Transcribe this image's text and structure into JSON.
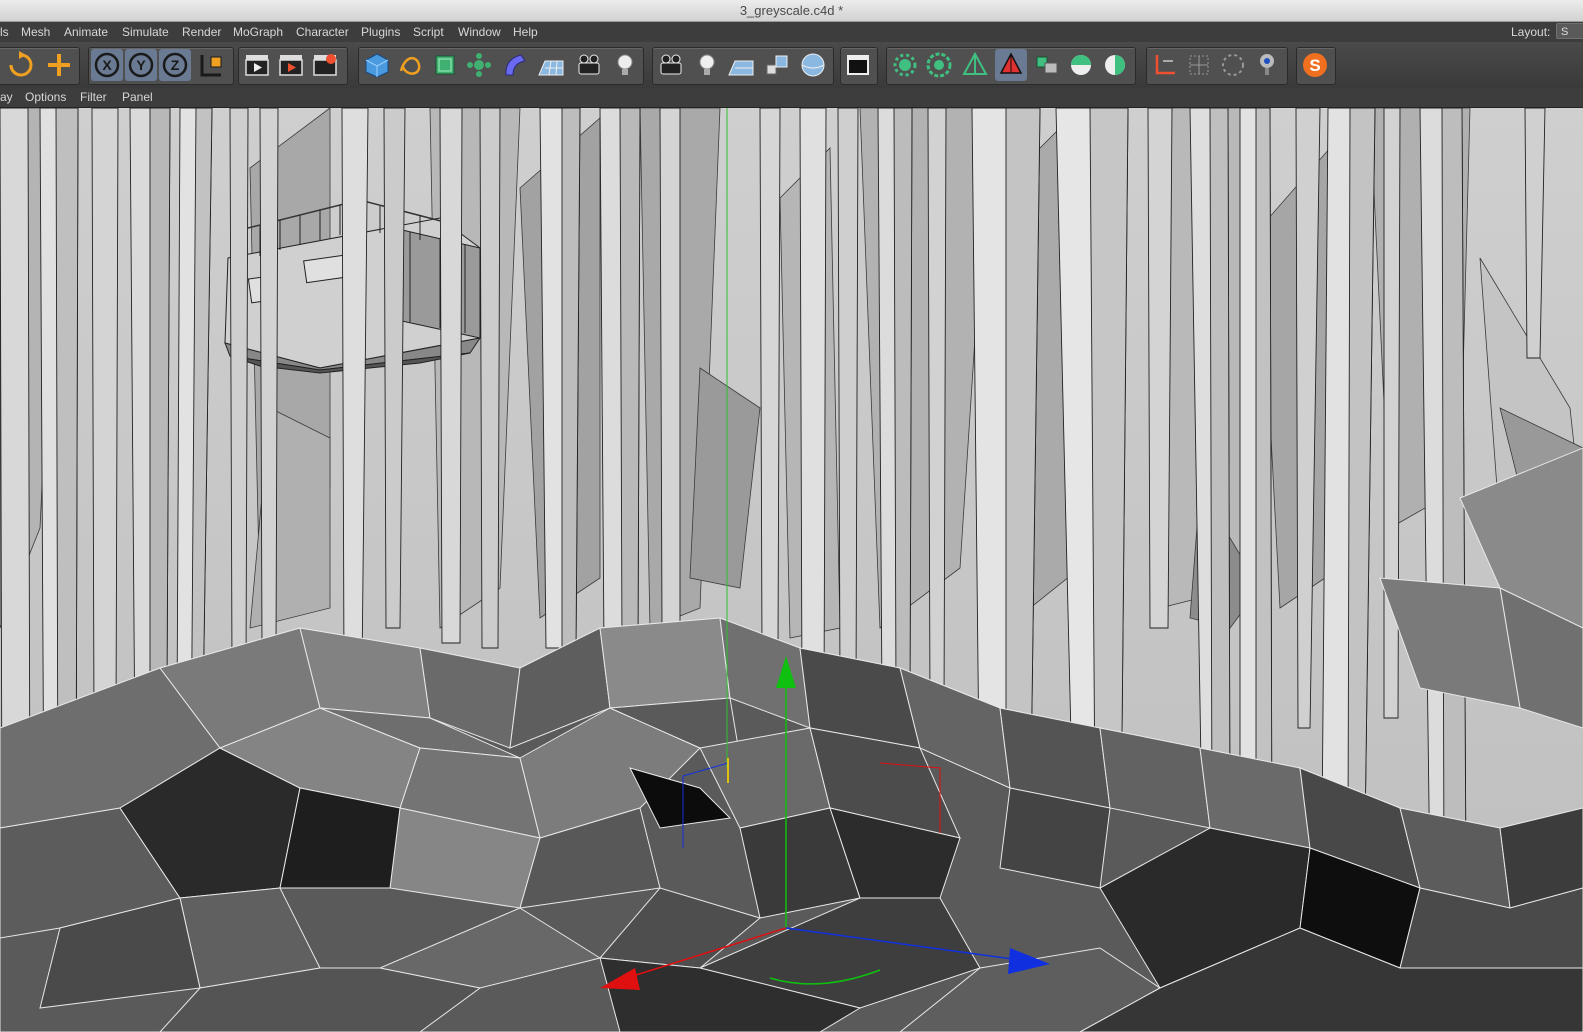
{
  "window": {
    "title": "3_greyscale.c4d *"
  },
  "menu": {
    "items": [
      {
        "id": "tools",
        "label": "ls"
      },
      {
        "id": "mesh",
        "label": "Mesh"
      },
      {
        "id": "animate",
        "label": "Animate"
      },
      {
        "id": "simulate",
        "label": "Simulate"
      },
      {
        "id": "render",
        "label": "Render"
      },
      {
        "id": "mograph",
        "label": "MoGraph"
      },
      {
        "id": "character",
        "label": "Character"
      },
      {
        "id": "plugins",
        "label": "Plugins"
      },
      {
        "id": "script",
        "label": "Script"
      },
      {
        "id": "window",
        "label": "Window"
      },
      {
        "id": "help",
        "label": "Help"
      }
    ],
    "layout_label": "Layout:",
    "layout_value": "S"
  },
  "view_menu": {
    "items": [
      {
        "id": "display",
        "label": "ay"
      },
      {
        "id": "options",
        "label": "Options"
      },
      {
        "id": "filter",
        "label": "Filter"
      },
      {
        "id": "panel",
        "label": "Panel"
      }
    ]
  },
  "toolbar": {
    "axis_x": "X",
    "axis_y": "Y",
    "axis_z": "Z",
    "logo_letter": "S"
  },
  "colors": {
    "accent_orange": "#f0a020",
    "axis_x": "#e01010",
    "axis_y": "#10c010",
    "axis_z": "#1030e0"
  }
}
